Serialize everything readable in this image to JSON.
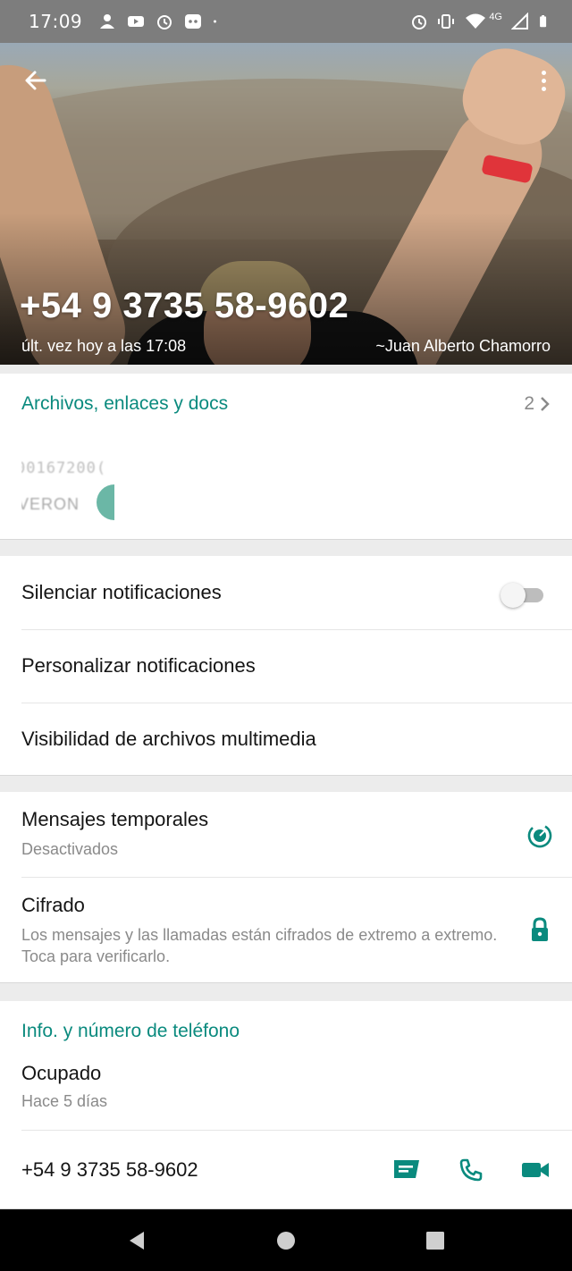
{
  "status_bar": {
    "time": "17:09",
    "network": "4G",
    "icons_left": [
      "person-icon",
      "youtube-icon",
      "alarm-icon",
      "cat-app-icon",
      "dot-icon"
    ],
    "icons_right": [
      "alarm-icon",
      "vibrate-icon",
      "wifi-icon",
      "signal-icon",
      "battery-icon"
    ]
  },
  "header": {
    "contact_name": "+54 9 3735 58-9602",
    "last_seen": "últ. vez hoy a las 17:08",
    "push_name": "~Juan Alberto Chamorro"
  },
  "media": {
    "title": "Archivos, enlaces y docs",
    "count": "2",
    "thumb_line1": "00167200(",
    "thumb_line2": "VERON"
  },
  "notifications": {
    "mute": {
      "label": "Silenciar notificaciones",
      "enabled": false
    },
    "custom": {
      "label": "Personalizar notificaciones"
    },
    "media_visibility": {
      "label": "Visibilidad de archivos multimedia"
    }
  },
  "security": {
    "disappearing": {
      "title": "Mensajes temporales",
      "subtitle": "Desactivados"
    },
    "encryption": {
      "title": "Cifrado",
      "subtitle": "Los mensajes y las llamadas están cifrados de extremo a extremo. Toca para verificarlo."
    }
  },
  "info": {
    "title": "Info. y número de teléfono",
    "about": "Ocupado",
    "about_date": "Hace 5 días",
    "phone": "+54 9 3735 58-9602"
  },
  "colors": {
    "accent": "#0a8a7e",
    "status_bar": "#7d7d7d",
    "background": "#ececec"
  }
}
